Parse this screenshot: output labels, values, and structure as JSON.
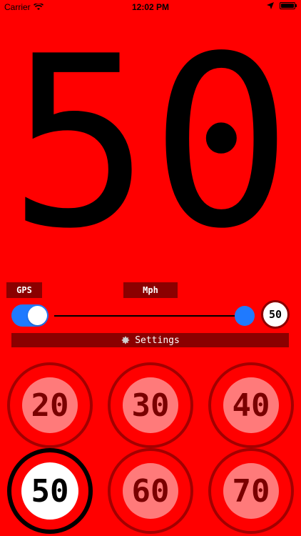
{
  "status": {
    "carrier": "Carrier",
    "time": "12:02 PM"
  },
  "speed": "50",
  "gps_label": "GPS",
  "unit_label": "Mph",
  "gps_enabled": true,
  "slider_value_fraction": 1.0,
  "current_limit": "50",
  "settings_label": "Settings",
  "signs": [
    "20",
    "30",
    "40",
    "50",
    "60",
    "70"
  ],
  "active_sign": "50",
  "colors": {
    "background": "#ff0000",
    "dark_red": "#8b0000",
    "accent": "#1f7aff"
  }
}
